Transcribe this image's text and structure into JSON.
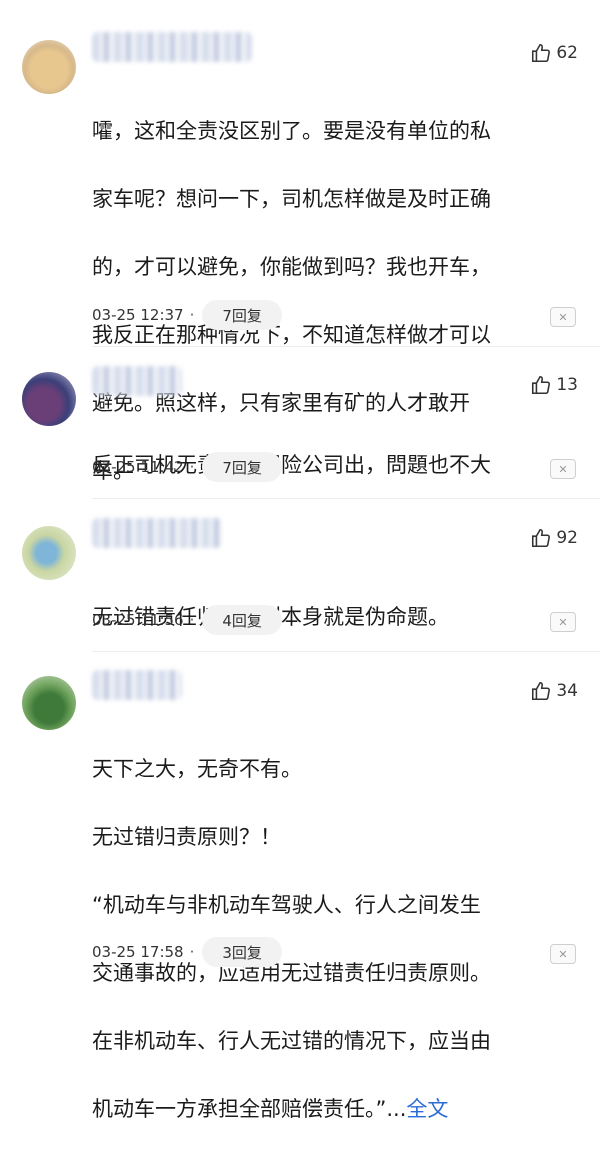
{
  "comments": [
    {
      "likes": "62",
      "lines": [
        "嚯，这和全责没区别了。要是没有单位的私",
        "家车呢？想问一下，司机怎样做是及时正确",
        "的，才可以避免，你能做到吗？我也开车，",
        "我反正在那种情况下，不知道怎样做才可以",
        "避免。照这样，只有家里有矿的人才敢开",
        "车。"
      ],
      "time": "03-25 12:37",
      "replies": "7回复"
    },
    {
      "likes": "13",
      "lines": [
        "反正司机无责，钱保险公司出，問題也不大"
      ],
      "time": "03-25 11:42",
      "replies": "7回复"
    },
    {
      "likes": "92",
      "lines": [
        "无过错责任归责原则本身就是伪命题。"
      ],
      "time": "03-25 11:56",
      "replies": "4回复"
    },
    {
      "likes": "34",
      "lines": [
        "天下之大，无奇不有。",
        "无过错归责原则？！",
        "“机动车与非机动车驾驶人、行人之间发生",
        "交通事故的，应适用无过错责任归责原则。",
        "在非机动车、行人无过错的情况下，应当由",
        "机动车一方承担全部赔偿责任。”..."
      ],
      "more": "全文",
      "time": "03-25 17:58",
      "replies": "3回复"
    }
  ],
  "dot": "·",
  "close_glyph": "✕",
  "colors": {
    "link": "#2b6bd6",
    "reply_bg": "#f2f2f2"
  },
  "icons": {
    "like": "thumbs-up-icon",
    "close": "close-icon"
  }
}
